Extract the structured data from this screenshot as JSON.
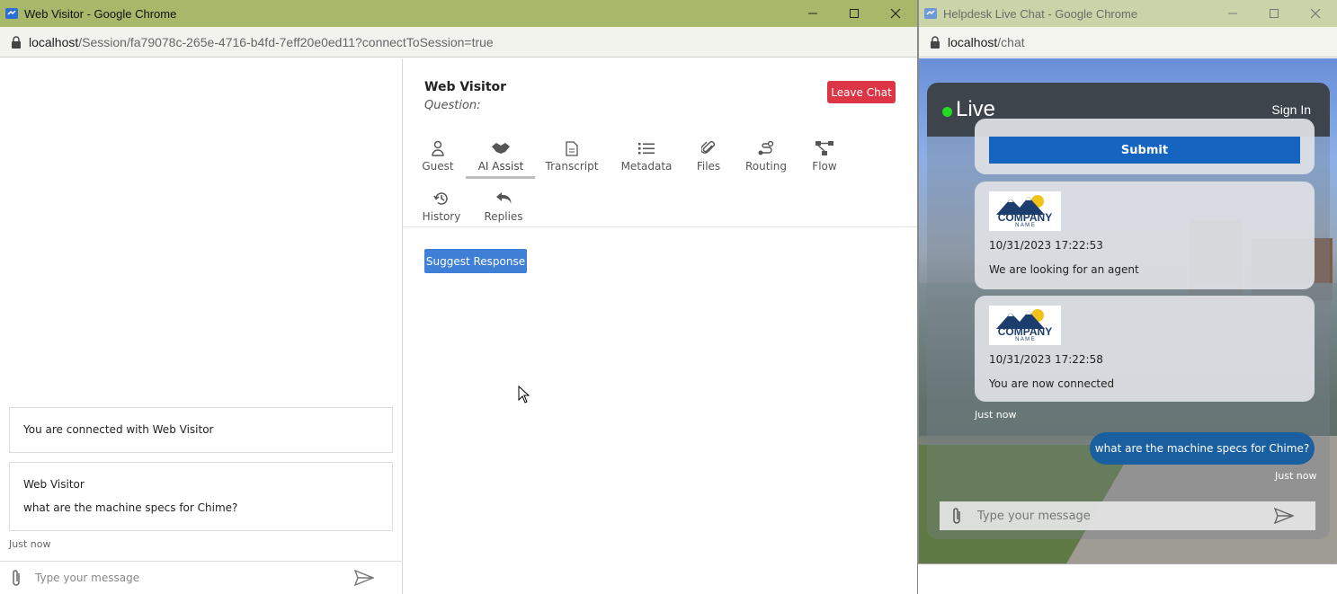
{
  "win1": {
    "title": "Web Visitor - Google Chrome",
    "address_host": "localhost",
    "address_path": "/Session/fa79078c-265e-4716-b4fd-7eff20e0ed11?connectToSession=true",
    "chat": {
      "system_message": "You are connected with Web Visitor",
      "visitor_name": "Web Visitor",
      "visitor_message": "what are the machine specs for Chime?",
      "timestamp": "Just now",
      "composer_placeholder": "Type your message"
    },
    "panel": {
      "visitor_name": "Web Visitor",
      "question_label": "Question:",
      "leave_label": "Leave Chat",
      "tabs": [
        {
          "label": "Guest",
          "icon": "person-icon"
        },
        {
          "label": "AI Assist",
          "icon": "handshake-icon"
        },
        {
          "label": "Transcript",
          "icon": "document-icon"
        },
        {
          "label": "Metadata",
          "icon": "list-icon"
        },
        {
          "label": "Files",
          "icon": "paperclip-icon"
        },
        {
          "label": "Routing",
          "icon": "route-icon"
        },
        {
          "label": "Flow",
          "icon": "flow-icon"
        },
        {
          "label": "History",
          "icon": "history-icon"
        },
        {
          "label": "Replies",
          "icon": "reply-icon"
        }
      ],
      "active_tab": "AI Assist",
      "suggest_label": "Suggest Response"
    }
  },
  "win2": {
    "title": "Helpdesk Live Chat - Google Chrome",
    "address_host": "localhost",
    "address_path": "/chat",
    "widget": {
      "live_label": "Live",
      "signin_label": "Sign In",
      "submit_label": "Submit",
      "messages": [
        {
          "logo_text": "COMPANY",
          "logo_sub": "N A M E",
          "datetime": "10/31/2023 17:22:53",
          "text": "We are looking for an agent"
        },
        {
          "logo_text": "COMPANY",
          "logo_sub": "N A M E",
          "datetime": "10/31/2023 17:22:58",
          "text": "You are now connected"
        }
      ],
      "agent_timestamp": "Just now",
      "user_message": "what are the machine specs for Chime?",
      "user_timestamp": "Just now",
      "composer_placeholder": "Type your message"
    }
  },
  "colors": {
    "titlebar_active": "#a7b86b",
    "leave_button": "#dc3545",
    "suggest_button": "#3f7fd6",
    "submit_button": "#1565c0",
    "user_bubble": "#1a5fa0",
    "live_dot": "#22dd22"
  }
}
